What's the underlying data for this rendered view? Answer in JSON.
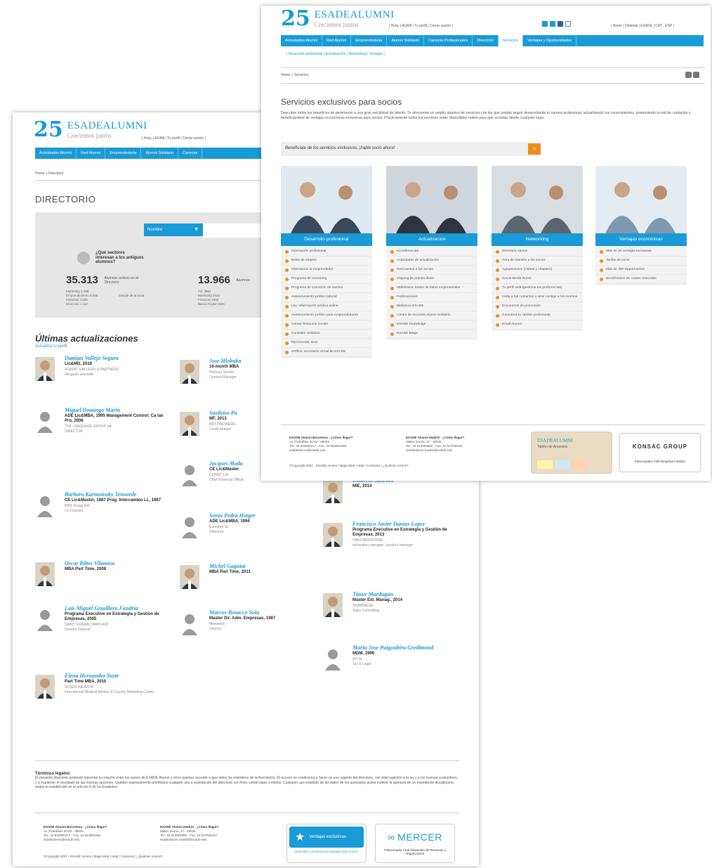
{
  "directory_page": {
    "logo": {
      "main": "ESADEALUMNI",
      "sub": "Creciemos juntos"
    },
    "user_bar": "| Hola, LAURA | Tu perfil | Cerrar sesión |",
    "nav": [
      "Actividades Alumni",
      "Red Alumni",
      "Emprendeduría",
      "Alumni Solidario",
      "Carreras"
    ],
    "breadcrumb": "Home > Directorio",
    "title": "DIRECTORIO",
    "search": {
      "select_label": "Nombre",
      "placeholder": ""
    },
    "question": "¿Qué sectores interesan a los antiguos alumnos?",
    "stats": [
      {
        "num": "35.313",
        "label": "Alumnos activos en el Directorio",
        "list": [
          "Marketing 2.488",
          "Emprendimiento 8.066",
          "Finanzas 3.533",
          "Dirección 1.112"
        ],
        "link": "Detalle de la Guía"
      },
      {
        "num": "13.966",
        "label": "Alumnos",
        "list": [
          "TIC 3962",
          "Marketing 2022",
          "Finanzas 2455",
          "Banca Digital 1566"
        ]
      }
    ],
    "updates_title": "Últimas actualizaciones",
    "updates_sub": "Actualiza tu perfil",
    "people": [
      {
        "name": "Damian Vallejo Segura",
        "degree": "Lic&MD, 2018",
        "company": "ALBERT GALLEGO & PARTNERS",
        "role": "Abogado asociado"
      },
      {
        "name": "Jose Hlobuka",
        "degree": "16-month MBA",
        "company": "Pinheiro Marfiel",
        "role": "General Manager"
      },
      {
        "name": "Miguel Domingo Marin",
        "degree": "ADE Lic&MBA, 1995 Management Control: Ca lan Pro, 2006",
        "company": "THE LANGUAGE GROUP SA",
        "role": "DIRECTOR"
      },
      {
        "name": "Vasileios Pa",
        "degree": "MF, 2013",
        "company": "BRT PREMIERS",
        "role": "Credit Analyst"
      },
      {
        "name": "Jacques Mada",
        "degree": "CE Lic&Master",
        "company": "CEREP S.A.",
        "role": "Chief Financial Officer"
      },
      {
        "name": "Barbara Karmoinsky Tenoorde",
        "degree": "CE Lic&Master, 1987 Prog. Intercambio LL, 1987",
        "company": "BMS Group 2eh",
        "role": "Co Founder"
      },
      {
        "name": "Sonia Pedra Hotger",
        "degree": "ADE Lic&MBA, 1994",
        "company": "Eurocred SL",
        "role": "Directora"
      },
      {
        "name": "Umberto Sanchez",
        "degree": "MIE, 2014",
        "company": "",
        "role": ""
      },
      {
        "name": "Francisco Javier Dantas Lopez",
        "degree": "Programa Executive en Estrategia y Gestión de Empresas, 2013",
        "company": "YAKS INDUSTRIAL",
        "role": "Innovation manager / product manager"
      },
      {
        "name": "Oscar Ribes Vilanova",
        "degree": "MBA Part Time, 2008",
        "company": "",
        "role": ""
      },
      {
        "name": "Michel Gagniat",
        "degree": "MBA Part Time, 2011",
        "company": "",
        "role": ""
      },
      {
        "name": "Timur Mardugan",
        "degree": "Master Ext. Manag., 2014",
        "company": "TERMINEDA",
        "role": "Sales Controlling"
      },
      {
        "name": "Luis Miguel Grasillera Fandria",
        "degree": "Programa Executive en Estrategia y Gestión de Empresas, 2005",
        "company": "SAINT GOBAIN CANPLAST",
        "role": "Director General"
      },
      {
        "name": "Marcos Bosacco Sola",
        "degree": "Master Dir. Adm. Empresas, 1987",
        "company": "Meesinha",
        "role": "Director"
      },
      {
        "name": "Maria Jose Paigoubira Gredimond",
        "degree": "MDM, 1999",
        "company": "AH SL",
        "role": "Tax & Legal"
      },
      {
        "name": "Elena Hernandez Yuste",
        "degree": "Part Time MBA, 2010",
        "company": "SOSEN INEAZON",
        "role": "International Medical Adviser & Country Marketing Cotem"
      }
    ],
    "legal": {
      "title": "Términos legales:",
      "text": "El presente directorio pretende fomentar la relación entre los socios de ESADE Alumni y otros quienes acceder a que éstos los miembros de la Asociación. El acceso se condiciona a hacer un uso urgente del directorio, con total sujeción a la ley y a las buenas costumbres, y a mantener el resultado de las mismas opciones. Quedan expresamente prohibidos cualquier uso o explotación del directorio con fines comerciales o ilícitos. Cualquier uso indebido de los datos de los asociados podrá motivar la apertura de un expediente disciplinario, según lo establecido en el artículo 6 de los Estatutos."
    },
    "footer": {
      "bcn": [
        "ESADE Alumni Barcelona - ¿Cómo llegar?",
        "Av. Pedralbes 60-62 - 08034",
        "Tel.: 34.932800217 - Fax: 34.934953348",
        "esadealumni@esade.edu"
      ],
      "mad": [
        "ESADE Alumni Madrid - ¿Cómo llegar?",
        "Mateo Inurria, 27 - 28036",
        "Tel.: 34.913592660 - Fax: 34.917030342",
        "esadealumni.madrid@esade.edu"
      ],
      "copyright": "©Copyright 2007 - ESADE Alumni | Mapa Web | Help | Contactar | ¿Quiénes somos?",
      "badge1": {
        "title": "Ventajas exclusivas",
        "sub": "Descubre y promociona ventajas para socios"
      },
      "badge2": {
        "title": "MERCER",
        "sub": "Patrocinador Club Desarrollo de Personas y Organización"
      }
    }
  },
  "services_page": {
    "logo": {
      "main": "ESADEALUMNI",
      "sub": "Creciemos juntos"
    },
    "user_bar": "| Hola, LAURA | Tu perfil | Cerrar sesión |",
    "top_links": "| Home | Dietmail | ESADE | CAT · ESP |",
    "nav": [
      "Actividades Alumni",
      "Red Alumni",
      "Emprendeduría",
      "Alumni Solidario",
      "Carreras Profesionales",
      "Directorio",
      "Servicios",
      "Ventajas y Oportunidades"
    ],
    "active_nav": "Servicios",
    "subnav": "| Desarrollo profesional | Actualización | Networking | Ventajas |",
    "breadcrumb": "Home > Servicios",
    "title": "Servicios exclusivos para socios",
    "intro": "Descubre todos los beneficios de pertenecer a una gran red global de talento. Te ofrecemos un amplio abanico de servicios con los que podrás seguir desarrollando tu carrera profesional, actualizando tus conocimientos, potenciando tu red de contactos y beneficiándote de ventajas económicas exclusivas para socios. Prácticamente todos los servicios están disponibles online para que accedas desde cualquier lugar.",
    "cta": "Benefíciate de los servicios exclusivos, ¡hazte socio ahora!",
    "columns": [
      {
        "head": "Desarrollo profesional",
        "items": [
          "Orientación profesional",
          "Bolsa de empleo",
          "Orientación al emprendedor",
          "Programa de mentoring",
          "Programa de transición de carrera",
          "Asesoramiento jurídico laboral",
          "Ley: Información jurídica online",
          "Asesoramiento jurídico para emprendedores",
          "Career Resource Center",
          "Consultor Solidario",
          "Red ESADE BAN",
          "eOffice: secretaría virtual de ESADE"
        ]
      },
      {
        "head": "Actualización",
        "items": [
          "eConferencias",
          "Actividades de actualización",
          "Descuentos a los socios",
          "Clipping de prensa diario",
          "eBiblioteca: bases de datos empresariales",
          "Publicaciones",
          "Biblioteca ESADE",
          "Centro de recursos Alumni Solidario",
          "ESADE Knowledge",
          "ESADE Blogs"
        ]
      },
      {
        "head": "Networking",
        "items": [
          "Directorio Alumni",
          "Área de trámites a los socios",
          "Agrupaciones (clubes y chapters)",
          "Social Media Room",
          "Tu perfil web (gestiona tus preferencias)",
          "Invita a tus contactos a venir contigo a los eventos",
          "Encuentros de promoción",
          "Comunica tu cambio profesional",
          "Email Alumni"
        ]
      },
      {
        "head": "Ventajas económicas",
        "items": [
          "Más de 20 ventajas exclusivas",
          "Tarifas de socio",
          "Más de 300 Opportunities",
          "Beneficiarios de cuotas reducidas"
        ]
      }
    ],
    "footer": {
      "bcn": [
        "ESADE Alumni Barcelona - ¿Cómo llegar?",
        "Av. Pedralbes 60-62 - 08034",
        "Tel.: 34.932800217 - Fax: 34.934953348",
        "esadealumni@esade.edu"
      ],
      "mad": [
        "ESADE Alumni Madrid - ¿Cómo llegar?",
        "Mateo Inurria, 27 - 28036",
        "Tel.: 34.913592660 - Fax: 34.917030342",
        "esadealumni.madrid@esade.edu"
      ],
      "copyright": "©Copyright 2007 - ESADE Alumni | Mapa Web | Help | Contactar | ¿Quiénes somos?",
      "badge1": {
        "title": "ESADEALUMNI",
        "sub": "Tablón de Anuncios"
      },
      "badge2": {
        "title": "KONSAC GROUP",
        "sub": "Patrocinador Club Empresa Familiar"
      }
    }
  },
  "colors": {
    "brand_blue": "#1a9ad6",
    "accent_orange": "#f08c1e",
    "panel_gray": "#e6e6e6"
  }
}
